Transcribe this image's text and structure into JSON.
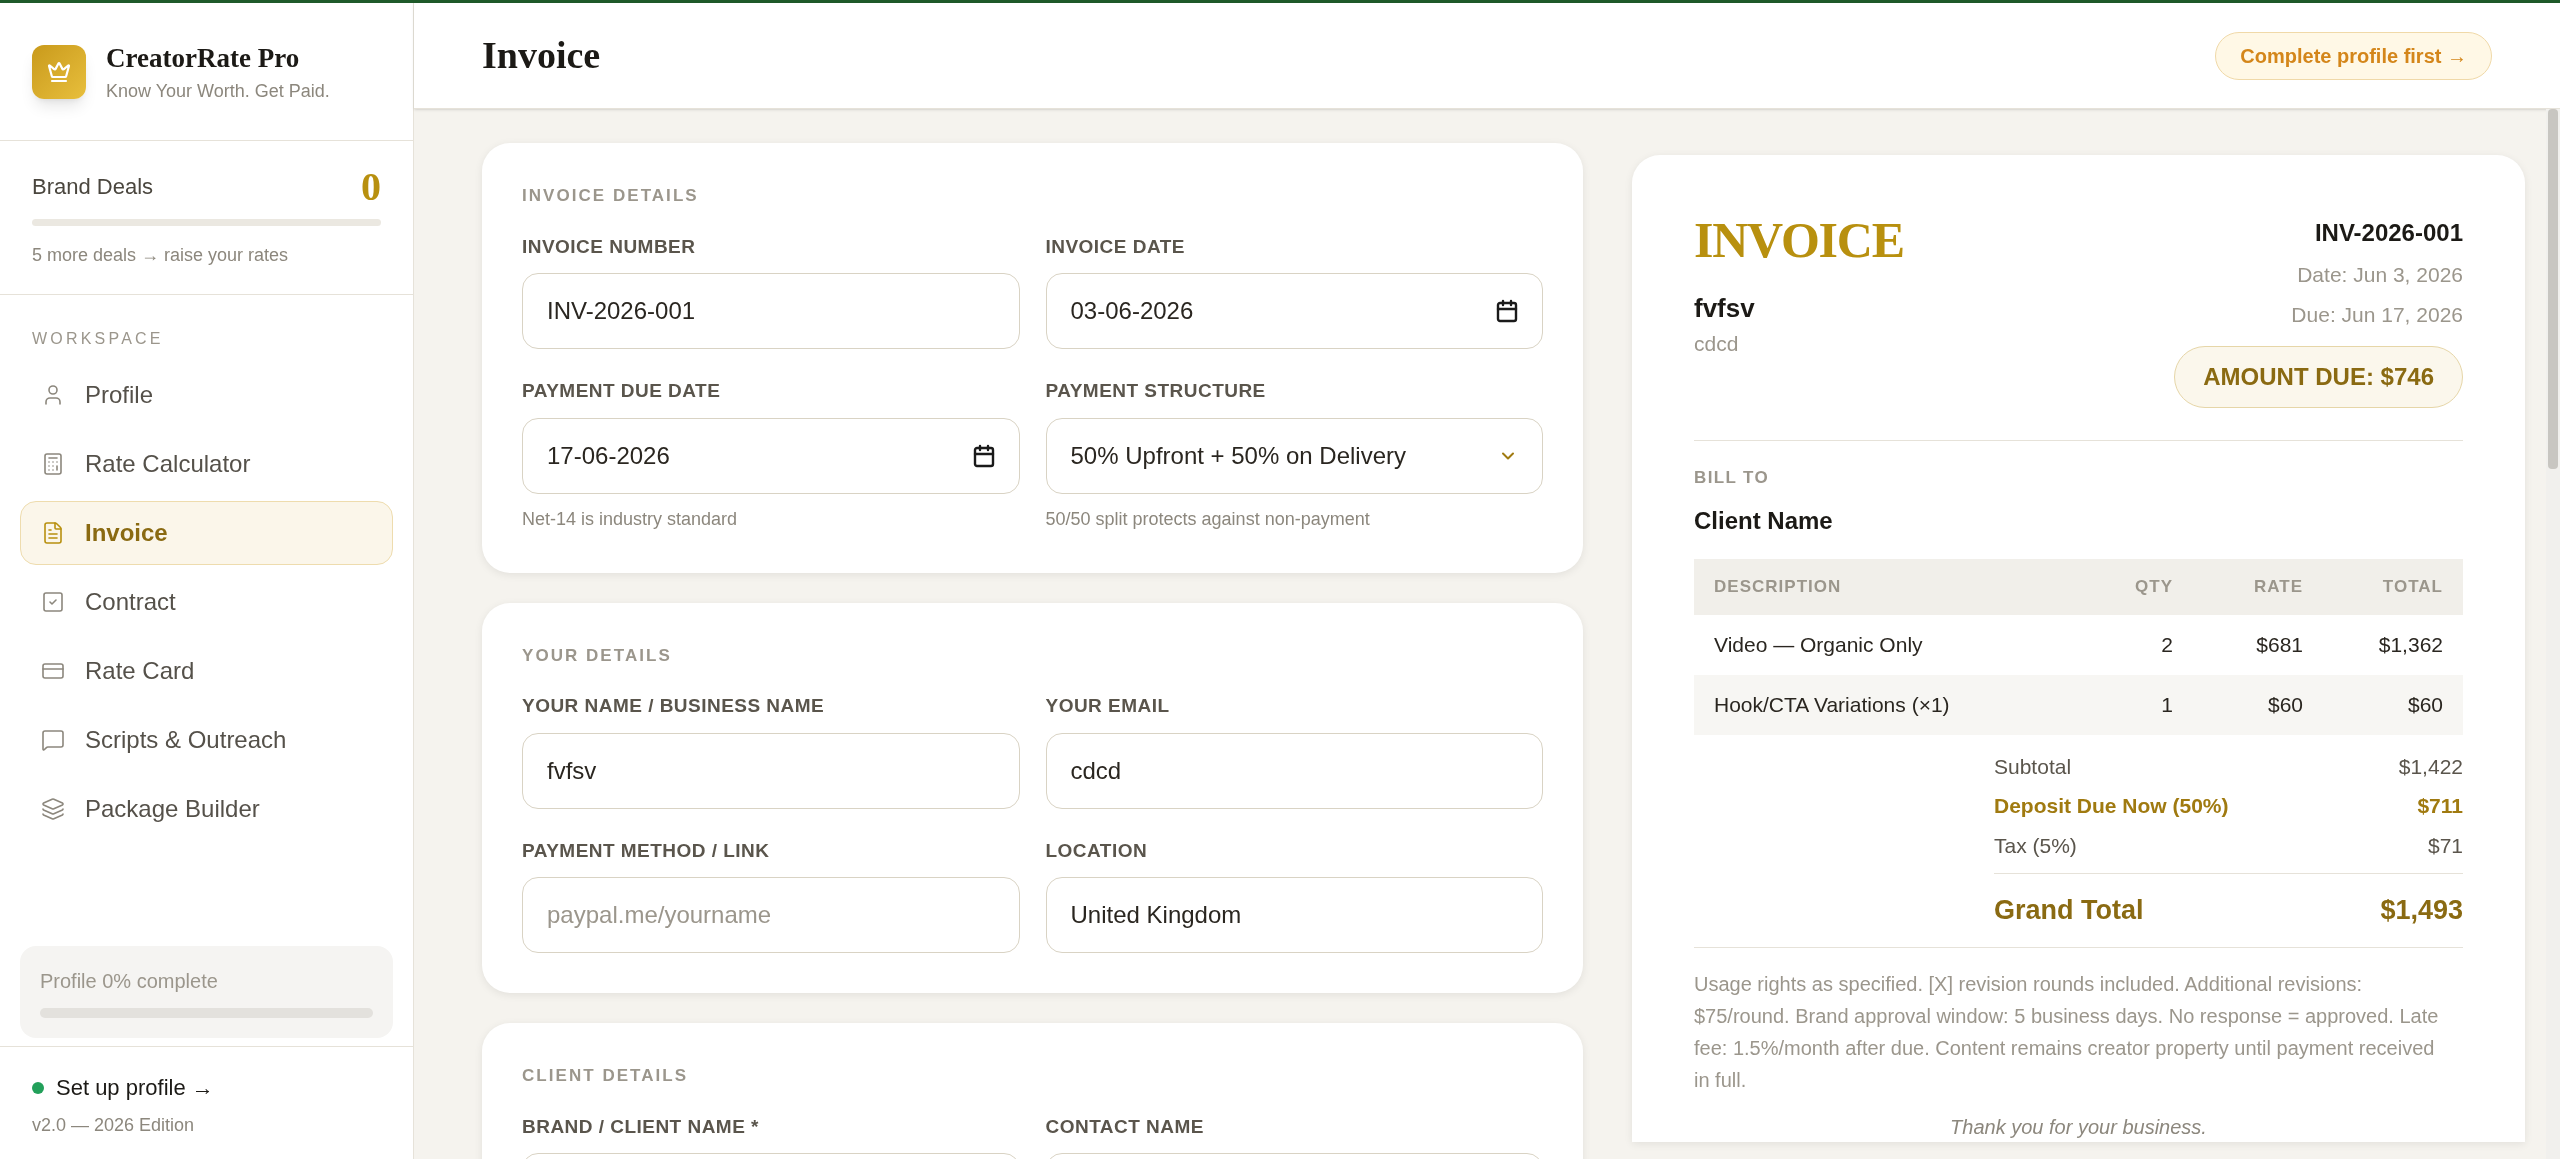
{
  "brand": {
    "name": "CreatorRate Pro",
    "tagline": "Know Your Worth. Get Paid."
  },
  "brand_deals": {
    "label": "Brand Deals",
    "count": "0",
    "level": 0,
    "hint": "5 more deals → raise your rates"
  },
  "nav": {
    "heading": "WORKSPACE",
    "items": [
      {
        "label": "Profile",
        "selected": false
      },
      {
        "label": "Rate Calculator",
        "selected": false
      },
      {
        "label": "Invoice",
        "selected": true
      },
      {
        "label": "Contract",
        "selected": false
      },
      {
        "label": "Rate Card",
        "selected": false
      },
      {
        "label": "Scripts & Outreach",
        "selected": false
      },
      {
        "label": "Package Builder",
        "selected": false
      }
    ]
  },
  "profile_progress": {
    "label": "Profile 0% complete",
    "level": 0
  },
  "footer": {
    "status": "Set up profile →",
    "version": "v2.0 — 2026 Edition"
  },
  "header": {
    "title": "Invoice",
    "action": "Complete profile first →"
  },
  "sections": [
    {
      "title": "INVOICE DETAILS",
      "fields": [
        {
          "label": "INVOICE NUMBER",
          "kind": "text",
          "value": "INV-2026-001"
        },
        {
          "label": "INVOICE DATE",
          "kind": "date",
          "value": "03-06-2026"
        },
        {
          "label": "PAYMENT DUE DATE",
          "kind": "date",
          "value": "17-06-2026",
          "hint": "Net-14 is industry standard"
        },
        {
          "label": "PAYMENT STRUCTURE",
          "kind": "select",
          "value": "50% Upfront + 50% on Delivery",
          "hint": "50/50 split protects against non-payment"
        }
      ]
    },
    {
      "title": "YOUR DETAILS",
      "fields": [
        {
          "label": "YOUR NAME / BUSINESS NAME",
          "kind": "text",
          "value": "fvfsv"
        },
        {
          "label": "YOUR EMAIL",
          "kind": "text",
          "value": "cdcd"
        },
        {
          "label": "PAYMENT METHOD / LINK",
          "kind": "text",
          "placeholder": "paypal.me/yourname"
        },
        {
          "label": "LOCATION",
          "kind": "text",
          "value": "United Kingdom"
        }
      ]
    },
    {
      "title": "CLIENT DETAILS",
      "fields": [
        {
          "label": "BRAND / CLIENT NAME *",
          "kind": "text"
        },
        {
          "label": "CONTACT NAME",
          "kind": "text"
        }
      ]
    }
  ],
  "preview": {
    "title": "INVOICE",
    "from_name": "fvfsv",
    "from_email": "cdcd",
    "number": "INV-2026-001",
    "date": "Date: Jun 3, 2026",
    "due": "Due: Jun 17, 2026",
    "amount_due": "AMOUNT DUE: $746",
    "bill_to_label": "BILL TO",
    "client": "Client Name",
    "table": {
      "columns": [
        "DESCRIPTION",
        "QTY",
        "RATE",
        "TOTAL"
      ],
      "rows": [
        [
          "Video — Organic Only",
          "2",
          "$681",
          "$1,362"
        ],
        [
          "Hook/CTA Variations (×1)",
          "1",
          "$60",
          "$60"
        ]
      ]
    },
    "totals": [
      {
        "label": "Subtotal",
        "value": "$1,422",
        "kind": "normal"
      },
      {
        "label": "Deposit Due Now (50%)",
        "value": "$711",
        "kind": "highlight"
      },
      {
        "label": "Tax (5%)",
        "value": "$71",
        "kind": "normal"
      },
      {
        "label": "Grand Total",
        "value": "$1,493",
        "kind": "grand"
      }
    ],
    "terms": "Usage rights as specified. [X] revision rounds included. Additional revisions: $75/round. Brand approval window: 5 business days. No response = approved. Late fee: 1.5%/month after due. Content remains creator property until payment received in full.",
    "thanks": "Thank you for your business."
  }
}
